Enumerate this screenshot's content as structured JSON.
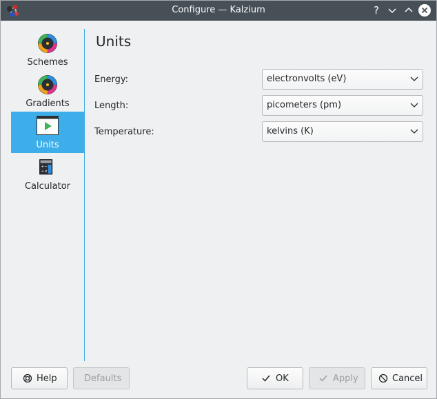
{
  "window": {
    "title": "Configure — Kalzium",
    "accent_color": "#3daee9",
    "titlebar_color": "#475057"
  },
  "sidebar": {
    "items": [
      {
        "label": "Schemes",
        "icon": "color-wheel-icon",
        "active": false
      },
      {
        "label": "Gradients",
        "icon": "color-wheel-icon",
        "active": false
      },
      {
        "label": "Units",
        "icon": "units-play-icon",
        "active": true
      },
      {
        "label": "Calculator",
        "icon": "calculator-icon",
        "active": false
      }
    ]
  },
  "main": {
    "title": "Units",
    "fields": [
      {
        "label": "Energy:",
        "value": "electronvolts (eV)"
      },
      {
        "label": "Length:",
        "value": "picometers (pm)"
      },
      {
        "label": "Temperature:",
        "value": "kelvins (K)"
      }
    ]
  },
  "buttons": {
    "help": "Help",
    "defaults": "Defaults",
    "ok": "OK",
    "apply": "Apply",
    "cancel": "Cancel"
  }
}
